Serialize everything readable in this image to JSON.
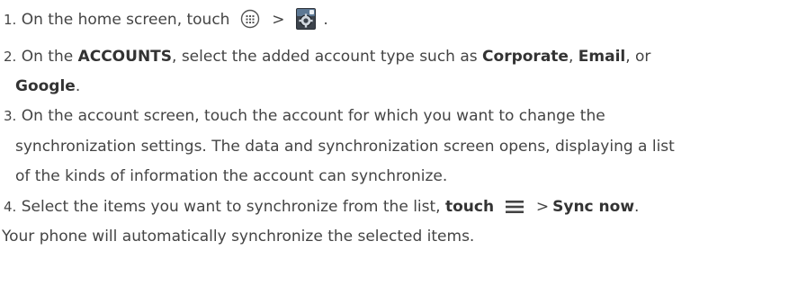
{
  "steps": [
    {
      "num": "1.",
      "text_a": " On the home screen, touch",
      "gt": ">",
      "end": ".",
      "icons": [
        "apps-grid-icon",
        "settings-icon"
      ]
    },
    {
      "num": "2.",
      "a": " On the ",
      "b1": "ACCOUNTS",
      "c": ", select the added account type such as ",
      "b2": "Corporate",
      "d": ", ",
      "b3": "Email",
      "e": ", or",
      "b4": "Google",
      "f": "."
    },
    {
      "num": "3.",
      "line1": " On the account screen, touch the account for which you want to change the",
      "line2": "synchronization settings. The data and synchronization screen opens, displaying a list",
      "line3": "of the kinds of information the account can synchronize."
    },
    {
      "num": "4.",
      "a": " Select the items you want to synchronize from the list, ",
      "b1": "touch",
      "gt": ">",
      "b2": "Sync now",
      "end": ".",
      "icons": [
        "menu-icon"
      ]
    }
  ],
  "footer": "Your phone will automatically synchronize the selected items."
}
